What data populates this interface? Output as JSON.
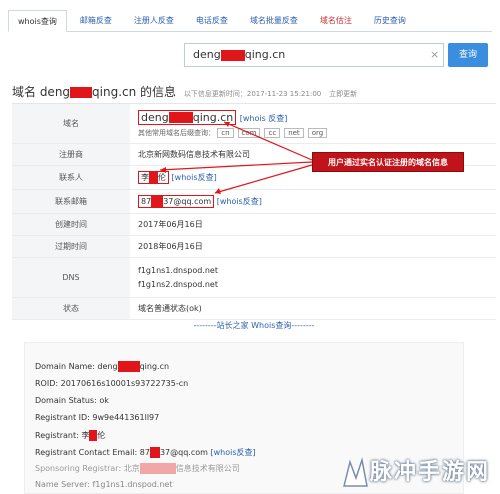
{
  "tabs": [
    {
      "label": "whois查询",
      "active": true
    },
    {
      "label": "邮箱反查"
    },
    {
      "label": "注册人反查"
    },
    {
      "label": "电话反查"
    },
    {
      "label": "域名批量反查"
    },
    {
      "label": "域名估注",
      "red": true
    },
    {
      "label": "历史查询"
    }
  ],
  "search": {
    "value_prefix": "deng",
    "value_suffix": "qing.cn",
    "clear": "×",
    "button": "查询"
  },
  "heading": {
    "prefix": "域名 deng",
    "suffix": "qing.cn 的信息",
    "updated": "以下信息更新时间：2017-11-23 15:21:00",
    "refresh": "立即更新"
  },
  "rows": {
    "domain": {
      "label": "域名",
      "value_prefix": "deng",
      "value_suffix": "qing.cn",
      "whois_link": "[whois 反查]",
      "other_label": "其他常用域名后缀查询：",
      "suffixes": [
        "cn",
        "com",
        "cc",
        "net",
        "org"
      ]
    },
    "registrar": {
      "label": "注册商",
      "value": "北京新网数码信息技术有限公司"
    },
    "contact": {
      "label": "联系人",
      "value_prefix": "李",
      "value_suffix": "伦",
      "link": "[whois反查]"
    },
    "email": {
      "label": "联系邮箱",
      "value_prefix": "87",
      "value_suffix": "37@qq.com",
      "link": "[whois反查]"
    },
    "created": {
      "label": "创建时间",
      "value": "2017年06月16日"
    },
    "expires": {
      "label": "过期时间",
      "value": "2018年06月16日"
    },
    "dns": {
      "label": "DNS",
      "values": [
        "f1g1ns1.dnspod.net",
        "f1g1ns2.dnspod.net"
      ]
    },
    "status": {
      "label": "状态",
      "value": "域名普通状态(ok)"
    }
  },
  "divider": "--------站长之家 Whois查询--------",
  "callout": "用户通过实名认证注册的域名信息",
  "raw": {
    "domain_prefix": "Domain Name: deng",
    "domain_suffix": "qing.cn",
    "roid": "ROID: 20170616s10001s93722735-cn",
    "status": "Domain Status: ok",
    "registrant_id": "Registrant ID: 9w9e441361ll97",
    "registrant_prefix": "Registrant: 李",
    "registrant_suffix": "伦",
    "email_prefix": "Registrant Contact Email: 87",
    "email_suffix": "37@qq.com",
    "email_link": "[whois反查]",
    "sponsor_prefix": "Sponsoring Registrar: 北京",
    "sponsor_suffix": "信息技术有限公司",
    "nameserver": "Name Server: f1g1ns1.dnspod.net"
  },
  "watermark": "脉冲手游网",
  "colors": {
    "accent": "#3b8de0",
    "redact": "#e0161a",
    "callout": "#c0131a",
    "link": "#2a5fb2"
  }
}
